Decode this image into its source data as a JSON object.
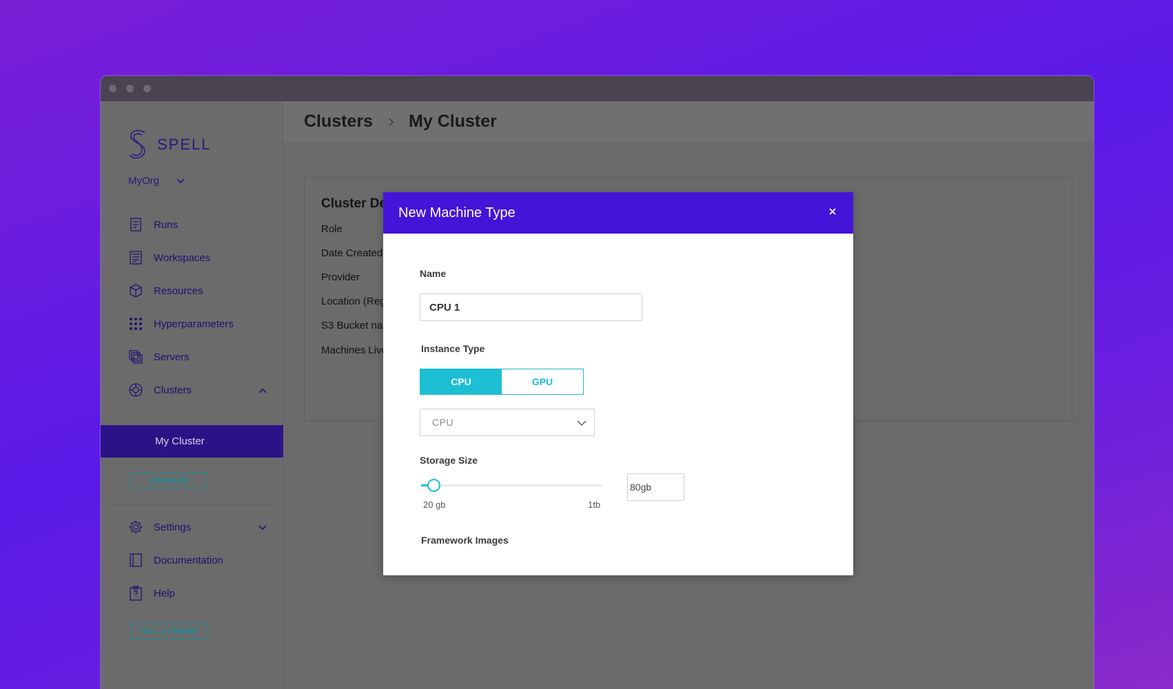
{
  "brand": {
    "name": "SPELL"
  },
  "org": {
    "name": "MyOrg"
  },
  "nav": {
    "items": [
      {
        "label": "Runs"
      },
      {
        "label": "Workspaces"
      },
      {
        "label": "Resources"
      },
      {
        "label": "Hyperparameters"
      },
      {
        "label": "Servers"
      },
      {
        "label": "Clusters"
      }
    ],
    "active_subitem": "My Cluster",
    "upgrade_label": "UPGRADE",
    "bottom_items": [
      {
        "label": "Settings"
      },
      {
        "label": "Documentation"
      },
      {
        "label": "Help"
      }
    ],
    "tell_friend_label": "TELL A FRIEND"
  },
  "breadcrumb": {
    "parent": "Clusters",
    "current": "My Cluster"
  },
  "cluster_card": {
    "title": "Cluster De",
    "rows": [
      "Role",
      "Date Created",
      "Provider",
      "Location (Reg",
      "S3 Bucket nar",
      "Machines Live"
    ]
  },
  "modal": {
    "title": "New Machine Type",
    "close_glyph": "×",
    "name_label": "Name",
    "name_value": "CPU 1",
    "instance_type_label": "Instance Type",
    "instance_options": [
      "CPU",
      "GPU"
    ],
    "instance_selected": "CPU",
    "instance_select_value": "CPU",
    "storage_label": "Storage Size",
    "storage_min_label": "20 gb",
    "storage_max_label": "1tb",
    "storage_value": "80gb",
    "storage_fraction": 0.07,
    "framework_label": "Framework Images"
  },
  "colors": {
    "accent": "#4414d8",
    "teal": "#1cbfd3",
    "nav_active": "#2a1386"
  }
}
